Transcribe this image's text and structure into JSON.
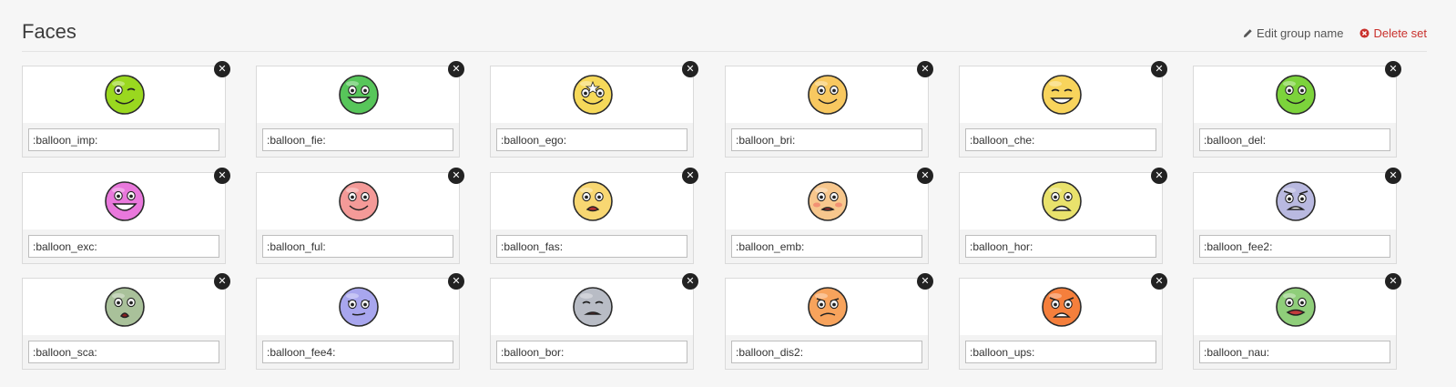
{
  "group": {
    "title": "Faces",
    "edit_label": "Edit group name",
    "delete_label": "Delete set"
  },
  "colors": {
    "delete": "#c9302c",
    "remove_button": "#222222"
  },
  "emoticons": [
    {
      "code": ":balloon_imp:",
      "face_color": "#9ad81f",
      "expression": "wink"
    },
    {
      "code": ":balloon_fie:",
      "face_color": "#57c65a",
      "expression": "grin"
    },
    {
      "code": ":balloon_ego:",
      "face_color": "#f6d95a",
      "expression": "star-smile"
    },
    {
      "code": ":balloon_bri:",
      "face_color": "#f8c860",
      "expression": "smile"
    },
    {
      "code": ":balloon_che:",
      "face_color": "#f8d45c",
      "expression": "happy"
    },
    {
      "code": ":balloon_del:",
      "face_color": "#7cd33b",
      "expression": "smile"
    },
    {
      "code": ":balloon_exc:",
      "face_color": "#e978dc",
      "expression": "excited"
    },
    {
      "code": ":balloon_ful:",
      "face_color": "#f49a98",
      "expression": "smile"
    },
    {
      "code": ":balloon_fas:",
      "face_color": "#f8d772",
      "expression": "surprised"
    },
    {
      "code": ":balloon_emb:",
      "face_color": "#f7c78d",
      "expression": "embarrassed"
    },
    {
      "code": ":balloon_hor:",
      "face_color": "#e9e26c",
      "expression": "horrified"
    },
    {
      "code": ":balloon_fee2:",
      "face_color": "#b9b9e0",
      "expression": "afraid"
    },
    {
      "code": ":balloon_sca:",
      "face_color": "#a9c19a",
      "expression": "scared"
    },
    {
      "code": ":balloon_fee4:",
      "face_color": "#a8a6ee",
      "expression": "meh"
    },
    {
      "code": ":balloon_bor:",
      "face_color": "#b8bcc5",
      "expression": "bored"
    },
    {
      "code": ":balloon_dis2:",
      "face_color": "#f7a35c",
      "expression": "displeased"
    },
    {
      "code": ":balloon_ups:",
      "face_color": "#f57f3c",
      "expression": "upset"
    },
    {
      "code": ":balloon_nau:",
      "face_color": "#8fce7a",
      "expression": "nauseous"
    }
  ]
}
